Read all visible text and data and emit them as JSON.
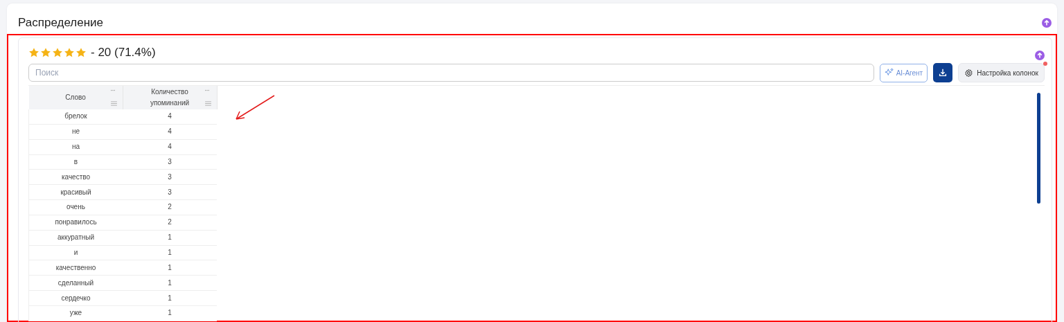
{
  "section": {
    "title": "Распределение"
  },
  "rating": {
    "stars": 5,
    "summary": "- 20 (71.4%)"
  },
  "search": {
    "placeholder": "Поиск"
  },
  "toolbar": {
    "ai_button": "AI-Агент",
    "columns_button": "Настройка колонок",
    "columns_notification": true
  },
  "table": {
    "columns": [
      "Слово",
      "Количество упоминаний"
    ],
    "rows": [
      [
        "брелок",
        "4"
      ],
      [
        "не",
        "4"
      ],
      [
        "на",
        "4"
      ],
      [
        "в",
        "3"
      ],
      [
        "качество",
        "3"
      ],
      [
        "красивый",
        "3"
      ],
      [
        "очень",
        "2"
      ],
      [
        "понравилось",
        "2"
      ],
      [
        "аккуратный",
        "1"
      ],
      [
        "и",
        "1"
      ],
      [
        "качественно",
        "1"
      ],
      [
        "сделанный",
        "1"
      ],
      [
        "сердечко",
        "1"
      ],
      [
        "уже",
        "1"
      ]
    ]
  }
}
